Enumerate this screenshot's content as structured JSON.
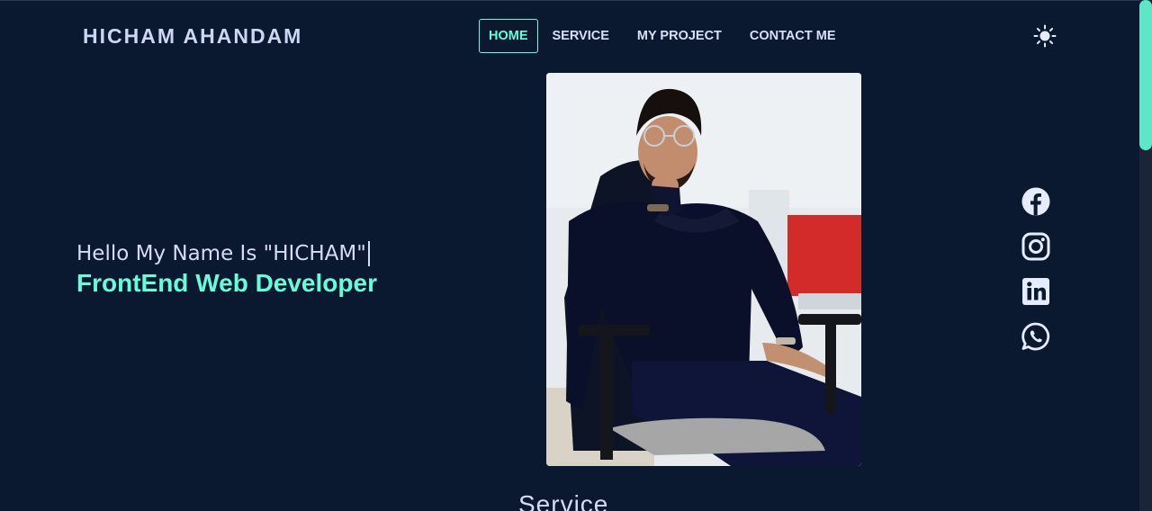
{
  "header": {
    "brand": "HICHAM AHANDAM",
    "nav": [
      {
        "label": "HOME",
        "active": true
      },
      {
        "label": "SERVICE",
        "active": false
      },
      {
        "label": "MY PROJECT",
        "active": false
      },
      {
        "label": "CONTACT ME",
        "active": false
      }
    ],
    "theme_icon": "sun-icon"
  },
  "hero": {
    "greeting": "Hello My Name Is \"HICHAM\"",
    "role": "FrontEnd Web Developer",
    "photo_icon": "profile-photo"
  },
  "social": [
    {
      "icon": "facebook-icon"
    },
    {
      "icon": "instagram-icon"
    },
    {
      "icon": "linkedin-icon"
    },
    {
      "icon": "whatsapp-icon"
    }
  ],
  "section": {
    "title": "Service"
  },
  "colors": {
    "background": "#0b1930",
    "accent": "#64ffda",
    "text": "#d6dcf5"
  }
}
